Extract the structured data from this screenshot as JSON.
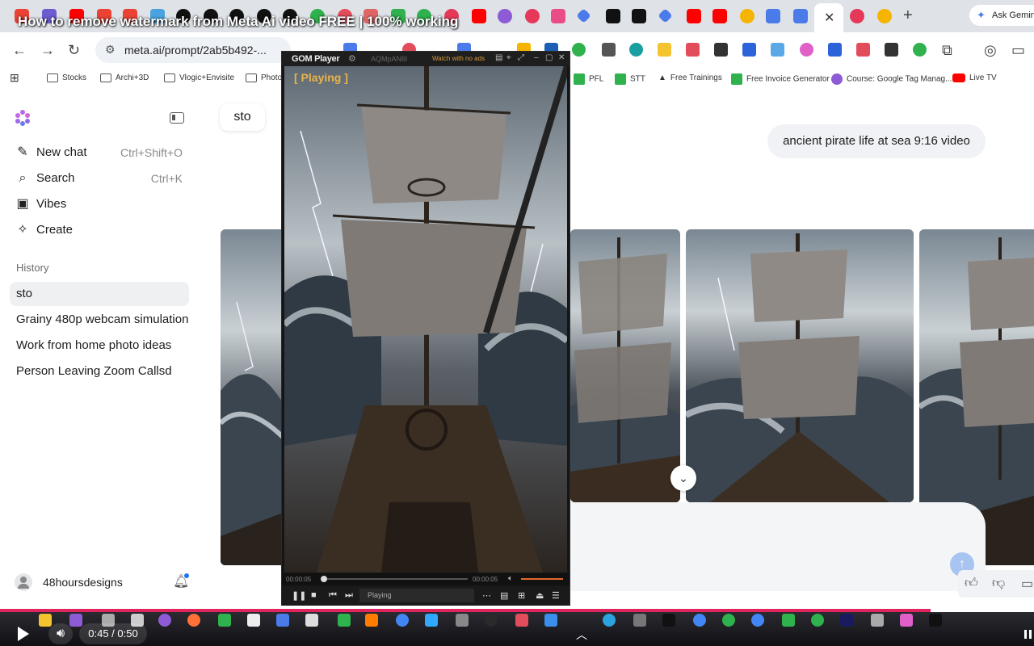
{
  "video_overlay": {
    "title": "How to remove watermark from Meta Ai video FREE | 100% working"
  },
  "browser": {
    "url": "meta.ai/prompt/2ab5b492-...",
    "ask_gemini": "Ask Gemini",
    "bookmarks": [
      {
        "label": "Stocks",
        "type": "folder"
      },
      {
        "label": "Archi+3D",
        "type": "folder"
      },
      {
        "label": "Vlogic+Envisite",
        "type": "folder"
      },
      {
        "label": "Photo",
        "type": "folder"
      },
      {
        "label": "PFL",
        "type": "site"
      },
      {
        "label": "STT",
        "type": "site"
      },
      {
        "label": "Free Trainings",
        "type": "site"
      },
      {
        "label": "Free Invoice Generator",
        "type": "site"
      },
      {
        "label": "Course: Google Tag Manag...",
        "type": "site"
      },
      {
        "label": "Live TV",
        "type": "site"
      }
    ],
    "accent_colors": {
      "youtube": "#ff0000",
      "gemini": "#4a7be8"
    }
  },
  "sidebar": {
    "nav": [
      {
        "label": "New chat",
        "shortcut": "Ctrl+Shift+O",
        "icon": "edit-icon"
      },
      {
        "label": "Search",
        "shortcut": "Ctrl+K",
        "icon": "search-icon"
      },
      {
        "label": "Vibes",
        "shortcut": "",
        "icon": "play-square-icon"
      },
      {
        "label": "Create",
        "shortcut": "",
        "icon": "sparkle-wand-icon"
      }
    ],
    "history_label": "History",
    "history": [
      "sto",
      "Grainy 480p webcam simulation",
      "Work from home photo ideas",
      "Person Leaving Zoom Callsd"
    ],
    "selected_history": "sto",
    "user": "48hoursdesigns"
  },
  "chat": {
    "title": "sto",
    "prompt": "ancient pirate life at sea 9:16 video"
  },
  "gom_player": {
    "app_name": "GOM Player",
    "file_name": "AQMpAN6l",
    "ads_label": "Watch with no ads",
    "status_overlay": "[ Playing ]",
    "elapsed": "00:00:05",
    "duration": "00:00:05",
    "status_text": "Playing",
    "playback_fraction": 0.0
  },
  "youtube_player": {
    "time": "0:45 / 0:50",
    "progress_fraction": 0.9,
    "progress_color": "#e0245e"
  }
}
